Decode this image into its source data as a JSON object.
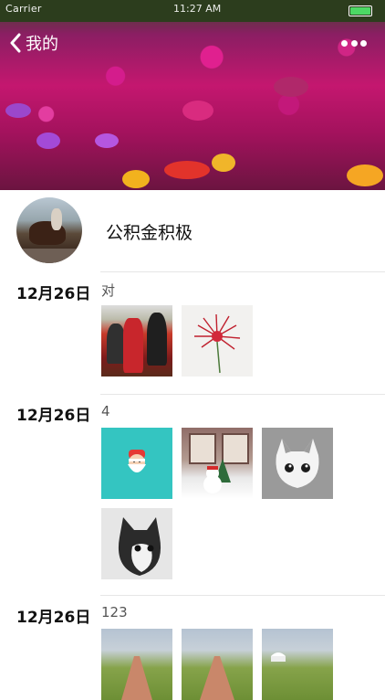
{
  "status_bar": {
    "carrier": "Carrier",
    "time": "11:27 AM"
  },
  "nav": {
    "back_label": "我的"
  },
  "profile": {
    "username": "公积金积极"
  },
  "moments": [
    {
      "date": "12月26日",
      "text": "对",
      "images": [
        "event-photo",
        "red-lily-drawing"
      ]
    },
    {
      "date": "12月26日",
      "text": "4",
      "images": [
        "santa-card",
        "snowman-photo",
        "white-cat-3d",
        "black-white-cat-3d"
      ]
    },
    {
      "date": "12月26日",
      "text": "123",
      "images": [
        "grassland-path-1",
        "grassland-path-2",
        "grassland-yurt"
      ]
    }
  ],
  "colors": {
    "accent_green": "#4cd964",
    "divider": "#e6e6e6"
  }
}
